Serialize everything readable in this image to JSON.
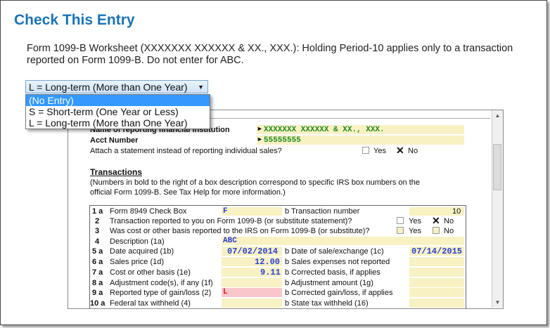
{
  "dialog": {
    "title": "Check This Entry",
    "message": "Form 1099-B Worksheet (XXXXXXX XXXXXX & XX., XXX.): Holding Period-10 applies only to a transaction reported on Form 1099-B. Do not enter for ABC."
  },
  "dropdown": {
    "selected": "L = Long-term (More than One Year)",
    "options": [
      "(No Entry)",
      "S = Short-term (One Year or Less)",
      "L = Long-term (More than One Year)"
    ],
    "highlighted_index": 0
  },
  "form": {
    "institution_label": "Name of reporting financial institution",
    "institution_value": "XXXXXXX XXXXXX & XX., XXX.",
    "acct_label": "Acct Number",
    "acct_value": "55555555",
    "attach_label": "Attach a statement instead of reporting individual sales?",
    "yes": "Yes",
    "no": "No",
    "transactions_heading": "Transactions",
    "transactions_note": "(Numbers in bold to the right of a box description correspond to specific IRS box numbers on the official Form 1099-B. See Tax Help for more information.)",
    "rows": {
      "r1_num": "1 a",
      "r1_label": "Form 8949 Check Box",
      "r1_value": "F",
      "r1b_label": "b Transaction number",
      "r1b_value": "10",
      "r2_num": "2",
      "r2_label": "Transaction reported to you on Form 1099-B (or substitute statement)?",
      "r3_num": "3",
      "r3_label": "Was cost or other basis reported to the IRS on Form 1099-B (or substitute)?",
      "r4_num": "4",
      "r4_label": "Description (1a)",
      "r4_value": "ABC",
      "r5_num": "5 a",
      "r5_label": "Date acquired (1b)",
      "r5_value": "07/02/2014",
      "r5b_label": "b Date of sale/exchange (1c)",
      "r5b_value": "07/14/2015",
      "r6_num": "6 a",
      "r6_label": "Sales price (1d)",
      "r6_value": "12.00",
      "r6b_label": "b Sales expenses not reported",
      "r7_num": "7 a",
      "r7_label": "Cost or other basis (1e)",
      "r7_value": "9.11",
      "r7b_label": "b Corrected basis, if applies",
      "r8_num": "8 a",
      "r8_label": "Adjustment code(s), if any (1f)",
      "r8b_label": "b Adjustment amount (1g)",
      "r9_num": "9 a",
      "r9_label": "Reported type of gain/loss (2)",
      "r9_value": "L",
      "r9b_label": "b Corrected gain/loss, if applies",
      "r10_num": "10 a",
      "r10_label": "Federal tax withheld (4)",
      "r10b_label": "b State tax withheld (16)"
    }
  }
}
